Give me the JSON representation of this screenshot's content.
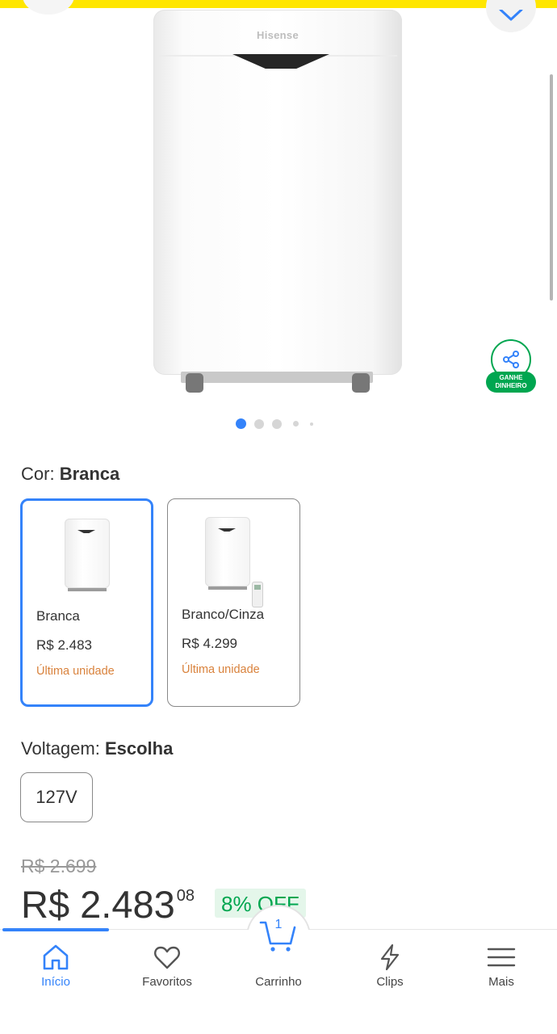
{
  "product": {
    "brand": "Hisense",
    "share_label_line1": "GANHE",
    "share_label_line2": "DINHEIRO"
  },
  "carousel": {
    "total_images": 5,
    "active_index": 0
  },
  "color": {
    "label": "Cor:",
    "value": "Branca",
    "options": [
      {
        "name": "Branca",
        "price": "R$ 2.483",
        "stock": "Última unidade",
        "selected": true
      },
      {
        "name": "Branco/Cinza",
        "price": "R$ 4.299",
        "stock": "Última unidade",
        "selected": false
      }
    ]
  },
  "voltage": {
    "label": "Voltagem:",
    "value": "Escolha",
    "options": [
      "127V"
    ]
  },
  "pricing": {
    "old_price": "R$ 2.699",
    "price": "R$ 2.483",
    "cents": "08",
    "discount": "8% OFF"
  },
  "nav": {
    "items": [
      {
        "label": "Início",
        "icon": "home-icon",
        "active": true
      },
      {
        "label": "Favoritos",
        "icon": "heart-icon",
        "active": false
      },
      {
        "label": "Carrinho",
        "icon": "cart-icon",
        "active": false,
        "count": "1"
      },
      {
        "label": "Clips",
        "icon": "lightning-icon",
        "active": false
      },
      {
        "label": "Mais",
        "icon": "menu-icon",
        "active": false
      }
    ]
  },
  "colors": {
    "accent": "#3483fa",
    "success": "#00a650",
    "warning": "#d9823c",
    "header": "#ffe600"
  }
}
